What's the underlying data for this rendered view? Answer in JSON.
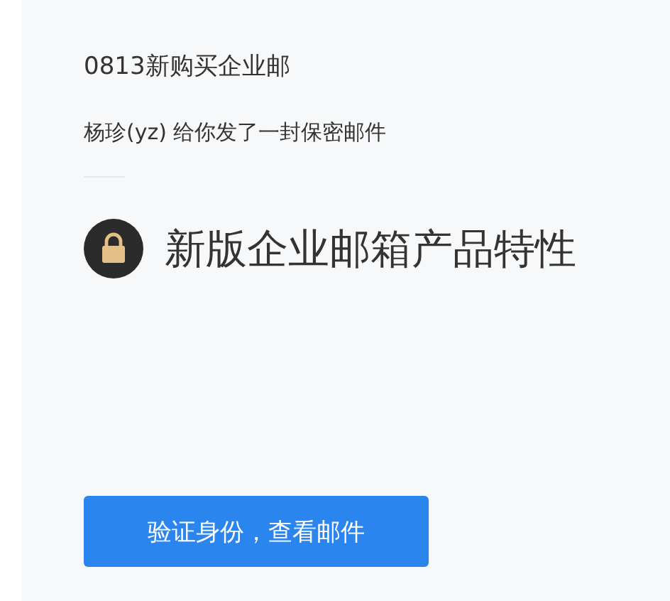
{
  "mail": {
    "subject": "0813新购买企业邮",
    "notice": "杨珍(yz) 给你发了一封保密邮件",
    "heading": "新版企业邮箱产品特性"
  },
  "button": {
    "label": "验证身份，查看邮件"
  }
}
